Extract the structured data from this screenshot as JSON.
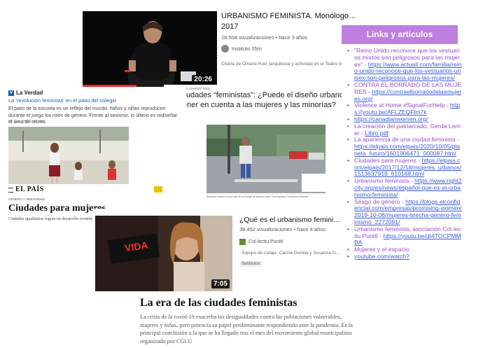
{
  "yt_top": {
    "title": "URBANISMO FEMINISTA. Monólogo de Oihan",
    "title_line2": "2017",
    "meta": "18.504 visualizaciones • hace 3 años",
    "channel": "Instituto 25m",
    "desc": "Charla de Oihane Ruiz (arquitecta y activista) en el Teatro del",
    "duration": "20:26",
    "channel_icon": "instituto-logo"
  },
  "la_verdad": {
    "brand": "La Verdad",
    "logo_letter": "V",
    "headline": "La 'revolución feminista' en el patio del colegio",
    "lead": "El patio de la escuela es un reflejo del mundo. Niños y niñas reproducen durante el juego los roles de género. Frente al sexismo, lo último es rediseñar el área de recreo",
    "date": "20 mar. 2018 (39 kB)"
  },
  "question_article": {
    "breadcrumb": "LEX | MARZO 2019",
    "title": "ciudades “feministas”: ¿Puede el diseño urbano tener en cuenta a las mujeres y las minorías?",
    "caption": "Apurada ciudad en una calle de la Ciudad de Buenos Aires. Juan Ignacio Cota/Banco Mundial"
  },
  "el_pais": {
    "brand": "EL PAÍS",
    "kicker": "GÉNERO Y URBANISMO",
    "title": "Ciudades para mujeres",
    "subtitle": "Ciudades igualitarias logran un desarrollo económico más próspero y sostenible"
  },
  "yt_bottom": {
    "title": "¿Qué es el urbanismo feminista? | Mo",
    "meta": "38.452 visualizaciones • hace 4 años",
    "channel": "Col·lectiu Punt6",
    "desc": "- Equipo de rodaje: Carme Gomila y Susanna Gonz",
    "subtitles": "Subtítulos",
    "duration": "7:05",
    "sign_text": "VIDA"
  },
  "feminist_cities": {
    "title": "La era de las ciudades feministas",
    "body": "La crisis de la covid-19 exacerba las desigualdades contra las poblaciones vulnerables, incluidas mujeres y niñas, pero potencia su papel predominante respondiendo ante la pandemia. Es la principal conclusión a la que se ha llegado tras el mes del movimiento global municipalista organizado por CGLU"
  },
  "links_panel": {
    "header": "Links y articulos",
    "header_color": "#bf7fe0",
    "items": [
      {
        "pre": "",
        "text": "\"Reino Unido reconoce que los vestuarios mixtos son peligrosos para las mujeres\"",
        "sep": " - ",
        "url": "https://www.actuall.com/familia/reino-unido-reconoce-que-los-vestuarios-unisex-son-peligrosos-para-las-mujeres/"
      },
      {
        "pre": "",
        "text": "CONTRA EL BORRADO DE LAS MUJERES",
        "sep": " - ",
        "url": "https://contraelborradodelasmujeres.org/"
      },
      {
        "pre": "",
        "text": "Violence at Home #SignalForHelp",
        "sep": " - ",
        "url": "https://youtu.be/AFLZEQFlm7k"
      },
      {
        "pre": "",
        "text": "",
        "sep": "",
        "url": "https://canadianwomen.org/"
      },
      {
        "pre": "",
        "text": "La creación del patriarcado, Gerda Lerner",
        "sep": " - ",
        "url": "Libro pdf"
      },
      {
        "pre": "",
        "text": "La apariencia de una ciudad feminista",
        "sep": " - ",
        "url": "https://elpais.com/elpais/2020/10/05/planeta_futuro/1601906471_000087.html"
      },
      {
        "pre": "",
        "text": "Ciudades para mujeres",
        "sep": " - ",
        "url": "https://elpais.com/elpais/2017/12/18/mujeres_urbanos/1513637919_610168.html"
      },
      {
        "pre": "",
        "text": "Urbanismo feminista",
        "sep": " - ",
        "url": "https://www.right2city.org/es/news/español-que-es-el-urbanismo-feminista/"
      },
      {
        "pre": "",
        "text": "Sesgo de género",
        "sep": " - ",
        "url": "https://blogs.elconfidencial.com/empresas/promising-women/2019-10-08/mujeres-brecha-genero-feminismo_2272091/"
      },
      {
        "pre": "",
        "text": "Urbanismo feminista, asociación Col·lectiu Punt6",
        "sep": " - ",
        "url": "https://youtu.be/dI4TOCPMMBA"
      },
      {
        "pre": "",
        "text": "Mujeres y el espacio",
        "sep": "",
        "url": ""
      },
      {
        "pre": "",
        "text": "",
        "sep": "",
        "url": "youtube.com/watch?"
      }
    ]
  },
  "colors": {
    "link": "#3d5bd9",
    "la_verdad_blue": "#1a5fa8",
    "yt_progress": "#ee2222",
    "links_header": "#bf7fe0"
  }
}
